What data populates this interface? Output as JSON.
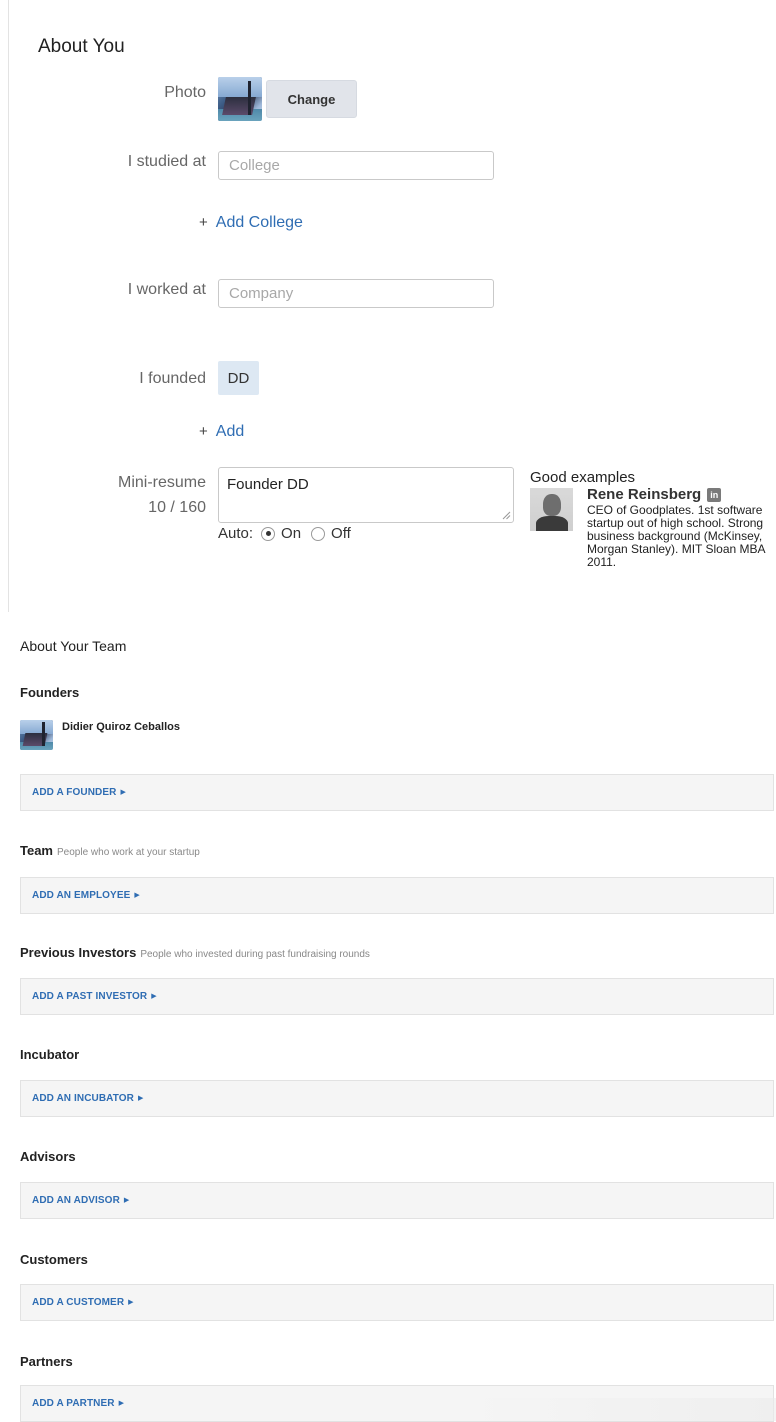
{
  "about_you": {
    "title": "About You",
    "photo_label": "Photo",
    "change_button": "Change",
    "studied_label": "I studied at",
    "college_placeholder": "College",
    "add_college": "Add College",
    "worked_label": "I worked at",
    "company_placeholder": "Company",
    "founded_label": "I founded",
    "founded_tag": "DD",
    "add_founded": "Add",
    "plus": "+",
    "resume_label": "Mini-resume",
    "resume_counter": "10 / 160",
    "resume_value": "Founder DD",
    "auto_label": "Auto:",
    "auto_on": "On",
    "auto_off": "Off",
    "auto_selected": "On",
    "good_examples": {
      "title": "Good examples",
      "name": "Rene Reinsberg",
      "badge": "in",
      "description": "CEO of Goodplates. 1st software startup out of high school. Strong business background (McKinsey, Morgan Stanley). MIT Sloan MBA 2011."
    }
  },
  "about_team": {
    "title": "About Your Team",
    "founders": {
      "heading": "Founders",
      "members": [
        "Didier Quiroz Ceballos"
      ],
      "add": "ADD A FOUNDER"
    },
    "team": {
      "heading": "Team",
      "sub": "People who work at your startup",
      "add": "ADD AN EMPLOYEE"
    },
    "previous_investors": {
      "heading": "Previous Investors",
      "sub": "People who invested during past fundraising rounds",
      "add": "ADD A PAST INVESTOR"
    },
    "incubator": {
      "heading": "Incubator",
      "add": "ADD AN INCUBATOR"
    },
    "advisors": {
      "heading": "Advisors",
      "add": "ADD AN ADVISOR"
    },
    "customers": {
      "heading": "Customers",
      "add": "ADD A CUSTOMER"
    },
    "partners": {
      "heading": "Partners",
      "add": "ADD A PARTNER"
    },
    "arrow_glyph": "▶"
  },
  "colors": {
    "link": "#2f6db3",
    "tag_bg": "#dde8f3",
    "button_bg": "#e1e4ea",
    "add_box_bg": "#f5f5f5"
  }
}
